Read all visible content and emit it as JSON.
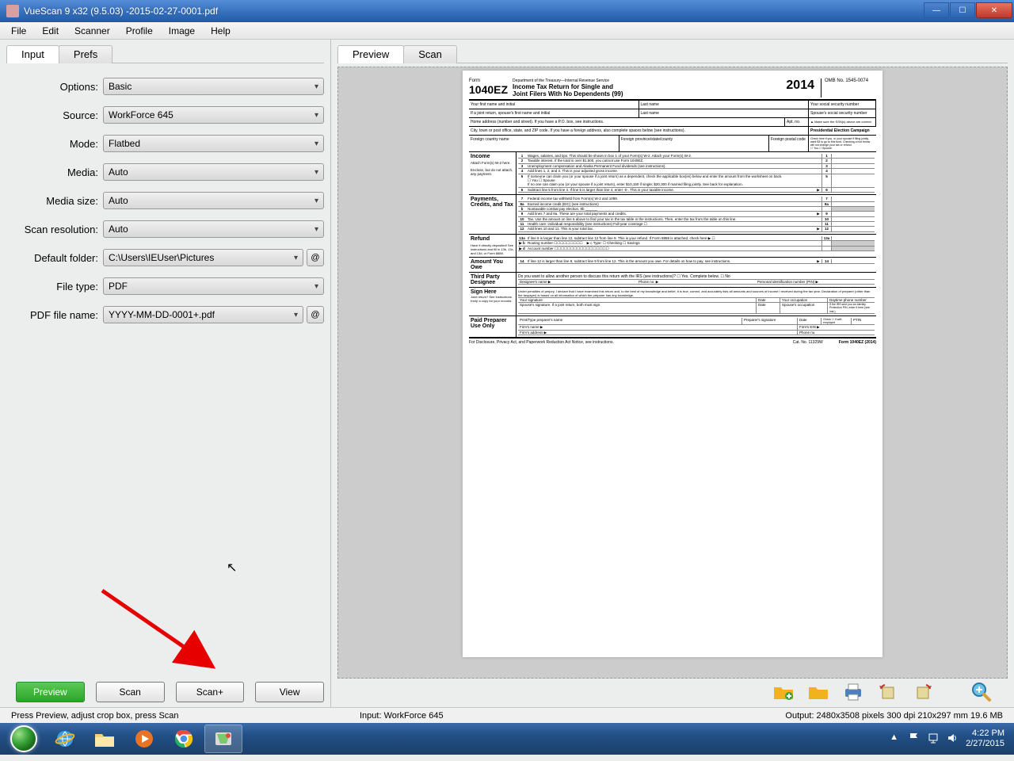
{
  "titlebar": {
    "title": "VueScan 9 x32 (9.5.03) -2015-02-27-0001.pdf"
  },
  "menu": [
    "File",
    "Edit",
    "Scanner",
    "Profile",
    "Image",
    "Help"
  ],
  "left_tabs": {
    "active": "Input",
    "other": "Prefs"
  },
  "form": {
    "options": {
      "label": "Options:",
      "value": "Basic"
    },
    "source": {
      "label": "Source:",
      "value": "WorkForce 645"
    },
    "mode": {
      "label": "Mode:",
      "value": "Flatbed"
    },
    "media": {
      "label": "Media:",
      "value": "Auto"
    },
    "media_size": {
      "label": "Media size:",
      "value": "Auto"
    },
    "scan_resolution": {
      "label": "Scan resolution:",
      "value": "Auto"
    },
    "default_folder": {
      "label": "Default folder:",
      "value": "C:\\Users\\IEUser\\Pictures"
    },
    "file_type": {
      "label": "File type:",
      "value": "PDF"
    },
    "pdf_file_name": {
      "label": "PDF file name:",
      "value": "YYYY-MM-DD-0001+.pdf"
    },
    "at": "@"
  },
  "buttons": {
    "preview": "Preview",
    "scan": "Scan",
    "scanplus": "Scan+",
    "view": "View"
  },
  "right_tabs": {
    "active": "Preview",
    "other": "Scan"
  },
  "document": {
    "form_no_prefix": "Form",
    "form_no": "1040EZ",
    "dept": "Department of the Treasury—Internal Revenue Service",
    "title1": "Income Tax Return for Single and",
    "title2": "Joint Filers With No Dependents  (99)",
    "year": "2014",
    "omb": "OMB No. 1545-0074",
    "name_first": "Your first name and initial",
    "name_last": "Last name",
    "ssn": "Your social security number",
    "spouse_first": "If a joint return, spouse's first name and initial",
    "spouse_last": "Last name",
    "spouse_ssn": "Spouse's social security number",
    "home_addr": "Home address (number and street). If you have a P.O. box, see instructions.",
    "apt": "Apt. no.",
    "ssn_note": "▲ Make sure the SSN(s) above are correct.",
    "city": "City, town or post office, state, and ZIP code. If you have a foreign address, also complete spaces below (see instructions).",
    "pres_campaign": "Presidential Election Campaign",
    "pres_text": "Check here if you, or your spouse if filing jointly, want $3 to go to this fund. Checking a box below will not change your tax or refund.",
    "pres_you": "You",
    "pres_spouse": "Spouse",
    "foreign_country": "Foreign country name",
    "foreign_prov": "Foreign province/state/county",
    "foreign_postal": "Foreign postal code",
    "sect_income": "Income",
    "income_sub": "Attach Form(s) W-2 here.",
    "income_sub2": "Enclose, but do not attach, any payment.",
    "line1": "Wages, salaries, and tips. This should be shown in box 1 of your Form(s) W-2. Attach your Form(s) W-2.",
    "line2": "Taxable interest. If the total is over $1,500, you cannot use Form 1040EZ.",
    "line3": "Unemployment compensation and Alaska Permanent Fund dividends (see instructions).",
    "line4": "Add lines 1, 2, and 3. This is your adjusted gross income.",
    "line5": "If someone can claim you (or your spouse if a joint return) as a dependent, check the applicable box(es) below and enter the amount from the worksheet on back.",
    "line5you": "☐ You     ☐ Spouse",
    "line5b": "If no one can claim you (or your spouse if a joint return), enter $10,150 if single; $20,300 if married filing jointly. See back for explanation.",
    "line6": "Subtract line 5 from line 4. If line 5 is larger than line 4, enter -0-. This is your taxable income.",
    "sect_payments": "Payments, Credits, and Tax",
    "line7": "Federal income tax withheld from Form(s) W-2 and 1099.",
    "line8a": "Earned income credit (EIC) (see instructions)",
    "line8b": "Nontaxable combat pay election.",
    "line9": "Add lines 7 and 8a. These are your total payments and credits.",
    "line10": "Tax. Use the amount on line 6 above to find your tax in the tax table in the instructions. Then, enter the tax from the table on this line.",
    "line11": "Health care: individual responsibility (see instructions)    Full-year coverage ☐",
    "line12": "Add lines 10 and 11. This is your total tax.",
    "sect_refund": "Refund",
    "refund_sub": "Have it directly deposited! See instructions and fill in 13b, 13c, and 13d, or Form 8888.",
    "line13a": "If line 9 is larger than line 12, subtract line 12 from line 9. This is your refund. If Form 8888 is attached, check here ▶ ☐",
    "line13b": "Routing number",
    "line13c": "▶ c Type: ☐ Checking ☐ Savings",
    "line13d": "Account number",
    "sect_owe": "Amount You Owe",
    "line14": "If line 12 is larger than line 9, subtract line 9 from line 12. This is the amount you owe. For details on how to pay, see instructions.",
    "sect_third": "Third Party Designee",
    "third_q": "Do you want to allow another person to discuss this return with the IRS (see instructions)?  ☐ Yes. Complete below.  ☐ No",
    "third_name": "Designee's name ▶",
    "third_phone": "Phone no. ▶",
    "third_pin": "Personal identification number (PIN) ▶",
    "sect_sign": "Sign Here",
    "sign_sub": "Joint return? See instructions. Keep a copy for your records.",
    "sign_text": "Under penalties of perjury, I declare that I have examined this return and, to the best of my knowledge and belief, it is true, correct, and accurately lists all amounts and sources of income I received during the tax year. Declaration of preparer (other than the taxpayer) is based on all information of which the preparer has any knowledge.",
    "sign_your": "Your signature",
    "sign_date": "Date",
    "sign_occ": "Your occupation",
    "sign_phone": "Daytime phone number",
    "sign_spouse": "Spouse's signature. If a joint return, both must sign.",
    "sign_sp_occ": "Spouse's occupation",
    "sign_pin": "If the IRS sent you an Identity Protection PIN, enter it here (see inst.)",
    "sect_paid": "Paid Preparer Use Only",
    "paid_name": "Print/Type preparer's name",
    "paid_sig": "Preparer's signature",
    "paid_date": "Date",
    "paid_check": "Check ☐ if self-employed",
    "paid_ptin": "PTIN",
    "paid_firm": "Firm's name ▶",
    "paid_ein": "Firm's EIN ▶",
    "paid_addr": "Firm's address ▶",
    "paid_phone": "Phone no.",
    "footer": "For Disclosure, Privacy Act, and Paperwork Reduction Act Notice, see instructions.",
    "catno": "Cat. No. 11329W",
    "formfoot": "Form 1040EZ (2014)"
  },
  "status": {
    "left": "Press Preview, adjust crop box, press Scan",
    "mid": "Input: WorkForce 645",
    "right": "Output: 2480x3508 pixels 300 dpi 210x297 mm 19.6 MB"
  },
  "tray": {
    "time": "4:22 PM",
    "date": "2/27/2015"
  }
}
